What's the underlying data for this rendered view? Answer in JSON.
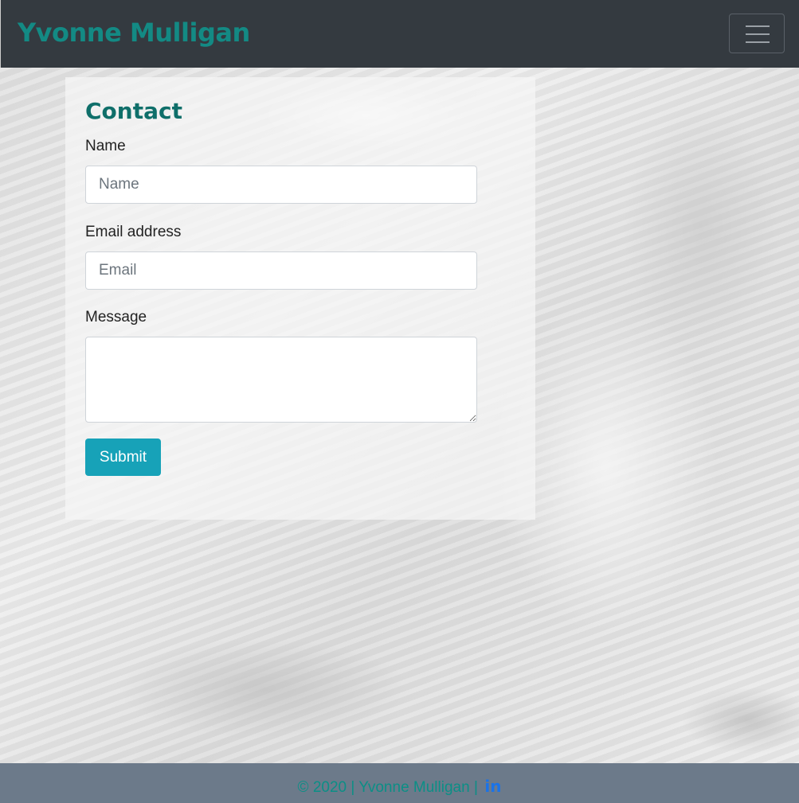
{
  "header": {
    "brand": "Yvonne Mulligan",
    "menu_icon": "hamburger-icon"
  },
  "contact": {
    "title": "Contact",
    "name_label": "Name",
    "name_placeholder": "Name",
    "email_label": "Email address",
    "email_placeholder": "Email",
    "message_label": "Message",
    "message_value": "",
    "submit_label": "Submit"
  },
  "footer": {
    "text": "© 2020 | Yvonne Mulligan |",
    "linkedin_label": "in",
    "linkedin_icon": "linkedin-icon"
  },
  "colors": {
    "navbar": "#343a40",
    "brand": "#138a84",
    "button": "#17a2b8",
    "footer": "#6c7a8a",
    "linkedin": "#1a73e8"
  }
}
